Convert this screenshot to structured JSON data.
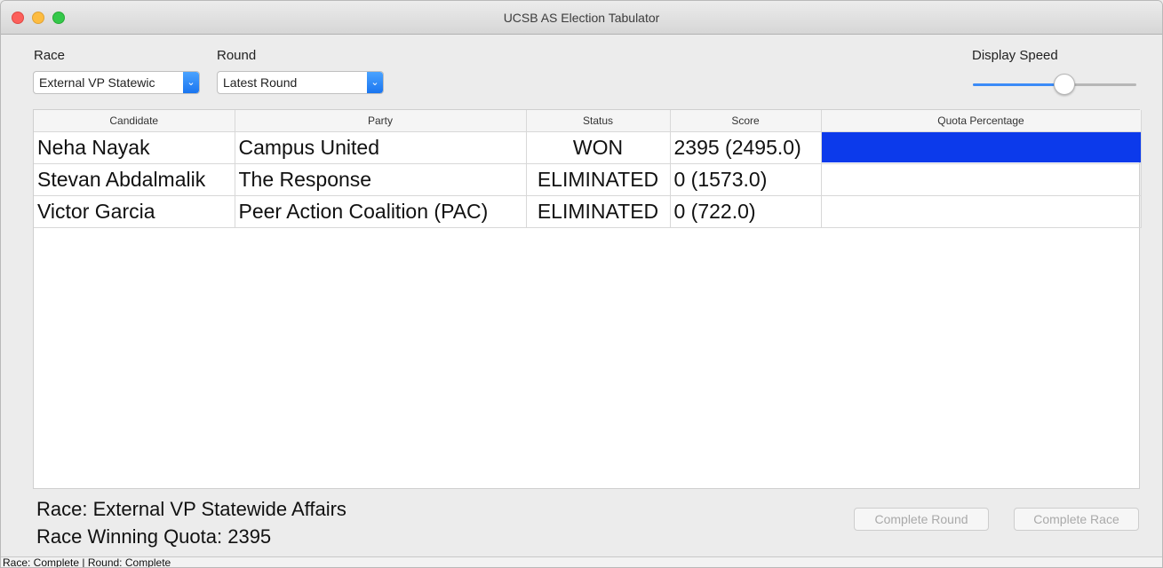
{
  "window": {
    "title": "UCSB AS Election Tabulator"
  },
  "controls": {
    "race_label": "Race",
    "race_value": "External VP Statewic",
    "round_label": "Round",
    "round_value": "Latest Round",
    "speed_label": "Display Speed",
    "speed_fraction": 0.56
  },
  "table": {
    "columns": [
      "Candidate",
      "Party",
      "Status",
      "Score",
      "Quota Percentage"
    ],
    "rows": [
      {
        "candidate": "Neha Nayak",
        "party": "Campus United",
        "status": "WON",
        "score": "2395 (2495.0)",
        "quota_fraction": 1.0
      },
      {
        "candidate": "Stevan Abdalmalik",
        "party": "The Response",
        "status": "ELIMINATED",
        "score": "0 (1573.0)",
        "quota_fraction": 0
      },
      {
        "candidate": "Victor Garcia",
        "party": "Peer Action Coalition (PAC)",
        "status": "ELIMINATED",
        "score": "0 (722.0)",
        "quota_fraction": 0
      }
    ],
    "quota_bar_color": "#0c3aeb"
  },
  "info": {
    "race_line": "Race: External VP Statewide Affairs",
    "quota_line": "Race Winning Quota: 2395"
  },
  "buttons": {
    "complete_round": "Complete Round",
    "complete_race": "Complete Race"
  },
  "status": {
    "text": "Race: Complete | Round: Complete"
  },
  "icons": {
    "stepper": "chevron-down-icon",
    "close": "close-window-icon",
    "minimize": "minimize-window-icon",
    "maximize": "maximize-window-icon"
  }
}
